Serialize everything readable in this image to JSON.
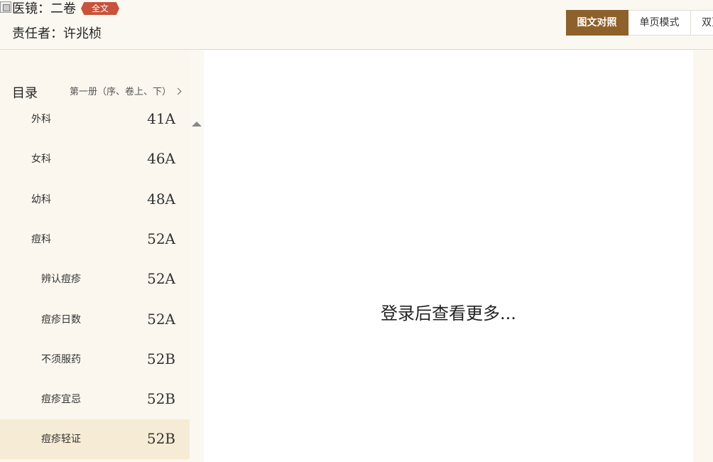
{
  "header": {
    "title": "医镜：二卷",
    "badge": "全文",
    "author": "责任者：许兆桢",
    "modes": [
      "图文对照",
      "单页模式",
      "双页模式"
    ]
  },
  "sidebar": {
    "toc_label": "目录",
    "volume": "第一册（序、卷上、下）",
    "items": [
      {
        "title": "外科",
        "page": "41A",
        "level": 1
      },
      {
        "title": "女科",
        "page": "46A",
        "level": 1
      },
      {
        "title": "幼科",
        "page": "48A",
        "level": 1
      },
      {
        "title": "痘科",
        "page": "52A",
        "level": 1
      },
      {
        "title": "辨认痘疹",
        "page": "52A",
        "level": 2
      },
      {
        "title": "痘疹日数",
        "page": "52A",
        "level": 2
      },
      {
        "title": "不须服药",
        "page": "52B",
        "level": 2
      },
      {
        "title": "痘疹宜忌",
        "page": "52B",
        "level": 2
      },
      {
        "title": "痘疹轻证",
        "page": "52B",
        "level": 2,
        "current": true
      }
    ]
  },
  "content": {
    "login_prompt": "登录后查看更多..."
  },
  "colors": {
    "accent": "#8d6129",
    "badge": "#c8523a",
    "current_item": "#f6ecd5"
  }
}
